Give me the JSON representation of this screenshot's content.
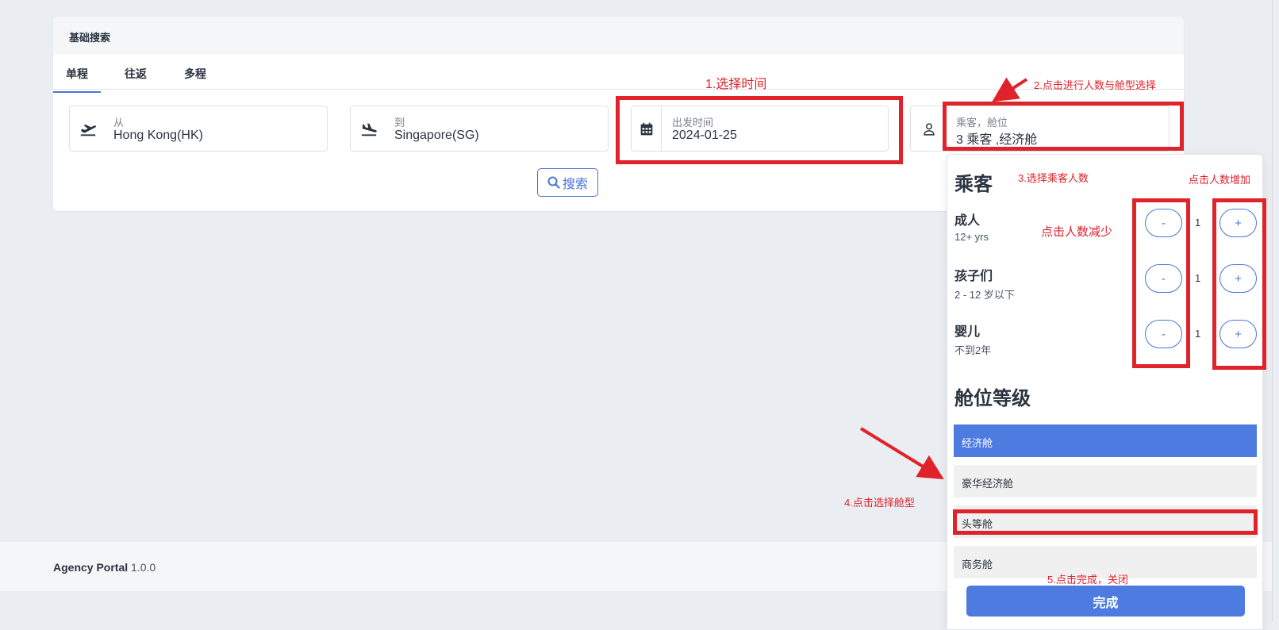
{
  "search_card": {
    "header": "基础搜索",
    "tabs": [
      {
        "label": "单程",
        "active": true
      },
      {
        "label": "往返",
        "active": false
      },
      {
        "label": "多程",
        "active": false
      }
    ],
    "from": {
      "caption": "从",
      "value": "Hong Kong(HK)",
      "icon": "plane-takeoff-icon"
    },
    "to": {
      "caption": "到",
      "value": "Singapore(SG)",
      "icon": "plane-landing-icon"
    },
    "date": {
      "caption": "出发时间",
      "value": "2024-01-25",
      "icon": "calendar-icon"
    },
    "passengers": {
      "caption": "乘客，舱位",
      "value": "3 乘客 ,经济舱",
      "icon": "user-icon"
    },
    "search_button": "搜索"
  },
  "passenger_panel": {
    "passengers_title": "乘客",
    "rows": [
      {
        "label": "成人",
        "sub": "12+ yrs",
        "count": "1",
        "minus": "-",
        "plus": "+"
      },
      {
        "label": "孩子们",
        "sub": "2 - 12 岁以下",
        "count": "1",
        "minus": "-",
        "plus": "+"
      },
      {
        "label": "婴儿",
        "sub": "不到2年",
        "count": "1",
        "minus": "-",
        "plus": "+"
      }
    ],
    "cabin_title": "舱位等级",
    "cabins": [
      {
        "label": "经济舱",
        "selected": true
      },
      {
        "label": "豪华经济舱",
        "selected": false
      },
      {
        "label": "头等舱",
        "selected": false
      },
      {
        "label": "商务舱",
        "selected": false
      }
    ],
    "done_button": "完成"
  },
  "footer": {
    "app_name": "Agency Portal",
    "version": "1.0.0"
  },
  "annotations": {
    "step1": "1.选择时间",
    "step2": "2.点击进行人数与舱型选择",
    "step3": "3.选择乘客人数",
    "increase": "点击人数增加",
    "decrease": "点击人数减少",
    "step4": "4.点击选择舱型",
    "step5": "5.点击完成，关闭"
  },
  "colors": {
    "accent": "#4874da",
    "selected": "#4e7be0",
    "annotation": "#e0222b"
  }
}
